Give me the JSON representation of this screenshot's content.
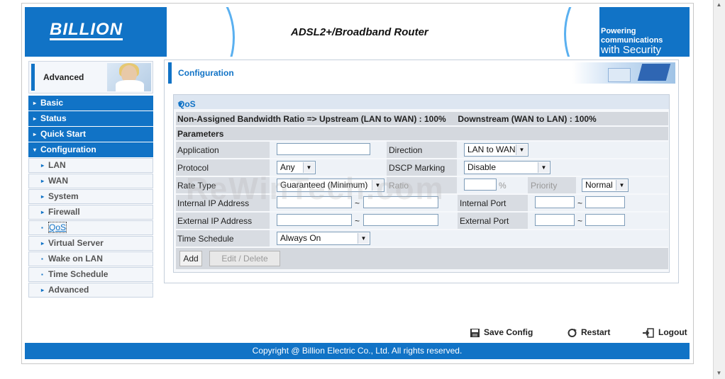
{
  "header": {
    "logo": "BILLION",
    "title": "ADSL2+/Broadband Router",
    "tagline_1": "Powering communications",
    "tagline_2": "with Security"
  },
  "sidebar": {
    "advanced_label": "Advanced",
    "items": [
      {
        "label": "Basic",
        "level": "main",
        "arrow": "▸"
      },
      {
        "label": "Status",
        "level": "main",
        "arrow": "▸"
      },
      {
        "label": "Quick Start",
        "level": "main",
        "arrow": "▸"
      },
      {
        "label": "Configuration",
        "level": "main",
        "arrow": "▾"
      },
      {
        "label": "LAN",
        "level": "sub",
        "arrow": "▸"
      },
      {
        "label": "WAN",
        "level": "sub",
        "arrow": "▸"
      },
      {
        "label": "System",
        "level": "sub",
        "arrow": "▸"
      },
      {
        "label": "Firewall",
        "level": "sub",
        "arrow": "▸"
      },
      {
        "label": "QoS",
        "level": "sub",
        "arrow": "▪",
        "active": true
      },
      {
        "label": "Virtual Server",
        "level": "sub",
        "arrow": "▸"
      },
      {
        "label": "Wake on LAN",
        "level": "sub",
        "arrow": "▪"
      },
      {
        "label": "Time Schedule",
        "level": "sub",
        "arrow": "▪"
      },
      {
        "label": "Advanced",
        "level": "sub",
        "arrow": "▸"
      }
    ]
  },
  "config": {
    "title": "Configuration"
  },
  "qos": {
    "section_title": "QoS",
    "bandwidth_line": "Non-Assigned Bandwidth Ratio => Upstream (LAN to WAN) : 100%     Downstream (WAN to LAN) : 100%",
    "parameters_label": "Parameters",
    "application_label": "Application",
    "application_value": "",
    "direction_label": "Direction",
    "direction_value": "LAN to WAN",
    "protocol_label": "Protocol",
    "protocol_value": "Any",
    "dscp_label": "DSCP Marking",
    "dscp_value": "Disable",
    "rate_type_label": "Rate Type",
    "rate_type_value": "Guaranteed (Minimum)",
    "ratio_label": "Ratio",
    "ratio_unit": "%",
    "priority_label": "Priority",
    "priority_value": "Normal",
    "internal_ip_label": "Internal IP Address",
    "internal_port_label": "Internal Port",
    "external_ip_label": "External IP Address",
    "external_port_label": "External Port",
    "range_sep": "~",
    "time_schedule_label": "Time Schedule",
    "time_schedule_value": "Always On",
    "add_button": "Add",
    "edit_delete_button": "Edit / Delete"
  },
  "actions": {
    "save": "Save Config",
    "restart": "Restart",
    "logout": "Logout"
  },
  "footer": {
    "copyright": "Copyright @ Billion Electric Co., Ltd. All rights reserved."
  },
  "watermark": "ReWinTech.com",
  "colors": {
    "brand": "#1173c6"
  }
}
